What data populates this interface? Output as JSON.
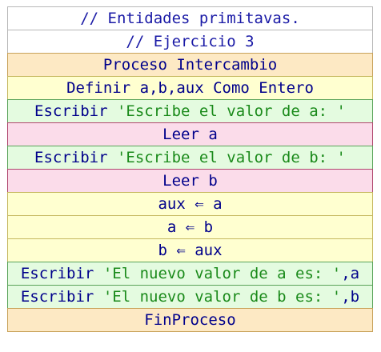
{
  "comments": [
    "// Entidades primitavas.",
    "// Ejercicio 3"
  ],
  "proceso": "Proceso Intercambio",
  "definir": "Definir a,b,aux Como Entero",
  "write1": {
    "kw": "Escribir ",
    "str": "'Escribe el valor de a: '"
  },
  "read1": "Leer a",
  "write2": {
    "kw": "Escribir ",
    "str": "'Escribe el valor de b: '"
  },
  "read2": "Leer b",
  "assign1": {
    "lhs": "aux ",
    "arrow": "⇐",
    "rhs": " a"
  },
  "assign2": {
    "lhs": "a ",
    "arrow": "⇐",
    "rhs": " b"
  },
  "assign3": {
    "lhs": "b ",
    "arrow": "⇐",
    "rhs": " aux"
  },
  "write3": {
    "kw": "Escribir ",
    "str": "'El nuevo valor de a es: '",
    "tail": ",a"
  },
  "write4": {
    "kw": "Escribir ",
    "str": "'El nuevo valor de b es: '",
    "tail": ",b"
  },
  "fin": "FinProceso",
  "colors": {
    "comment_text": "#1a1aa6",
    "keyword_text": "#00008b",
    "string_text": "#1a8a1a",
    "proceso_bg": "#fde9c4",
    "definir_bg": "#ffffd0",
    "escribir_bg": "#e4fbe0",
    "leer_bg": "#fbdcea"
  }
}
